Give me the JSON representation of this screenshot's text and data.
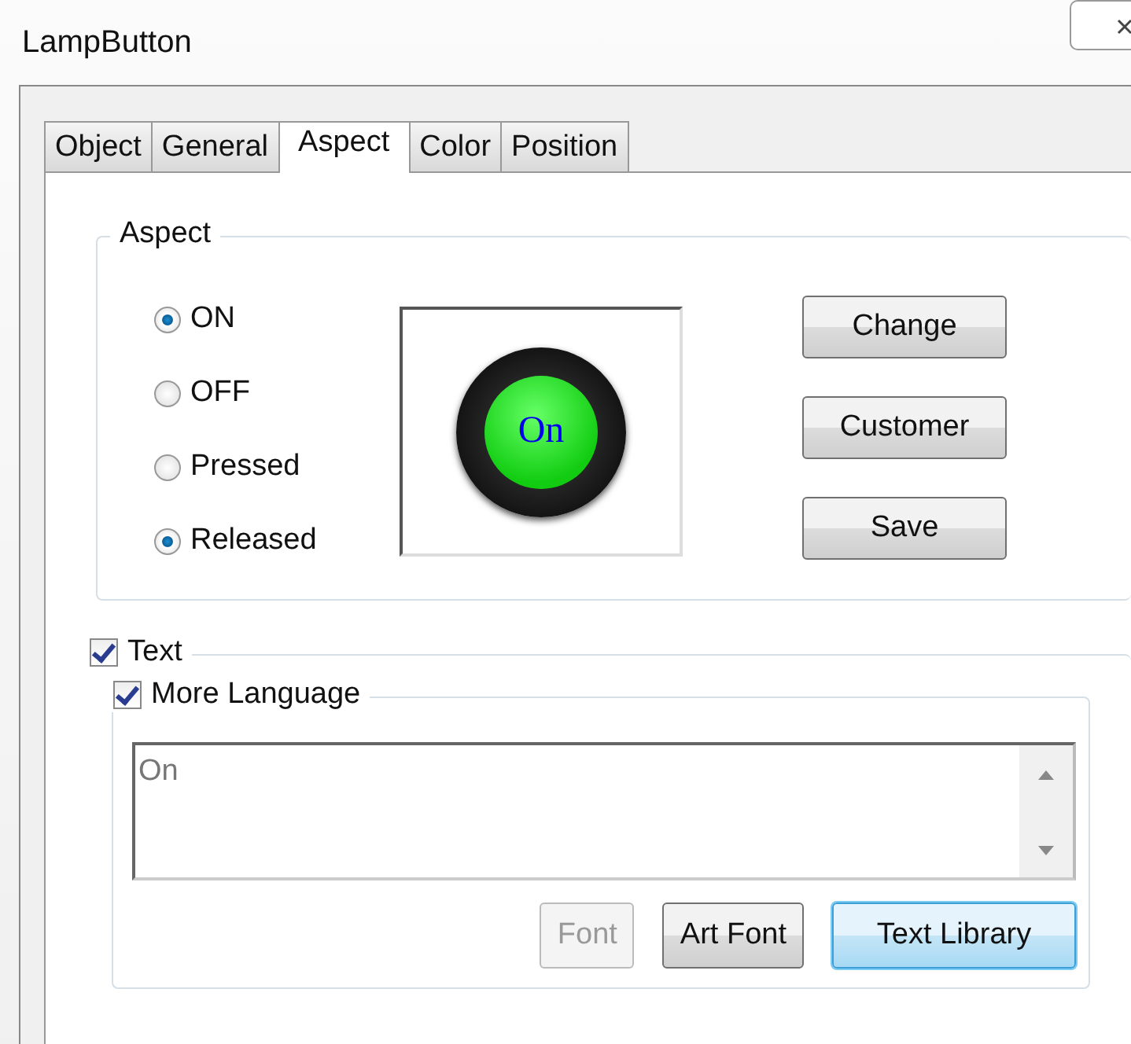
{
  "window": {
    "title": "LampButton"
  },
  "tabs": [
    {
      "label": "Object",
      "selected": false
    },
    {
      "label": "General",
      "selected": false
    },
    {
      "label": "Aspect",
      "selected": true
    },
    {
      "label": "Color",
      "selected": false
    },
    {
      "label": "Position",
      "selected": false
    }
  ],
  "aspect": {
    "title": "Aspect",
    "states": [
      {
        "label": "ON",
        "selected": true
      },
      {
        "label": "OFF",
        "selected": false
      },
      {
        "label": "Pressed",
        "selected": false
      },
      {
        "label": "Released",
        "selected": true
      }
    ],
    "preview": {
      "label": "On",
      "lamp_on": true
    },
    "buttons": [
      {
        "label": "Change"
      },
      {
        "label": "Customer"
      },
      {
        "label": "Save"
      }
    ]
  },
  "text": {
    "label": "Text",
    "checked": true,
    "more_language": {
      "label": "More Language",
      "checked": true
    },
    "value": "On",
    "buttons": [
      {
        "label": "Font",
        "disabled": true,
        "focused": false
      },
      {
        "label": "Art Font",
        "disabled": false,
        "focused": false
      },
      {
        "label": "Text Library",
        "disabled": false,
        "focused": true
      }
    ]
  }
}
